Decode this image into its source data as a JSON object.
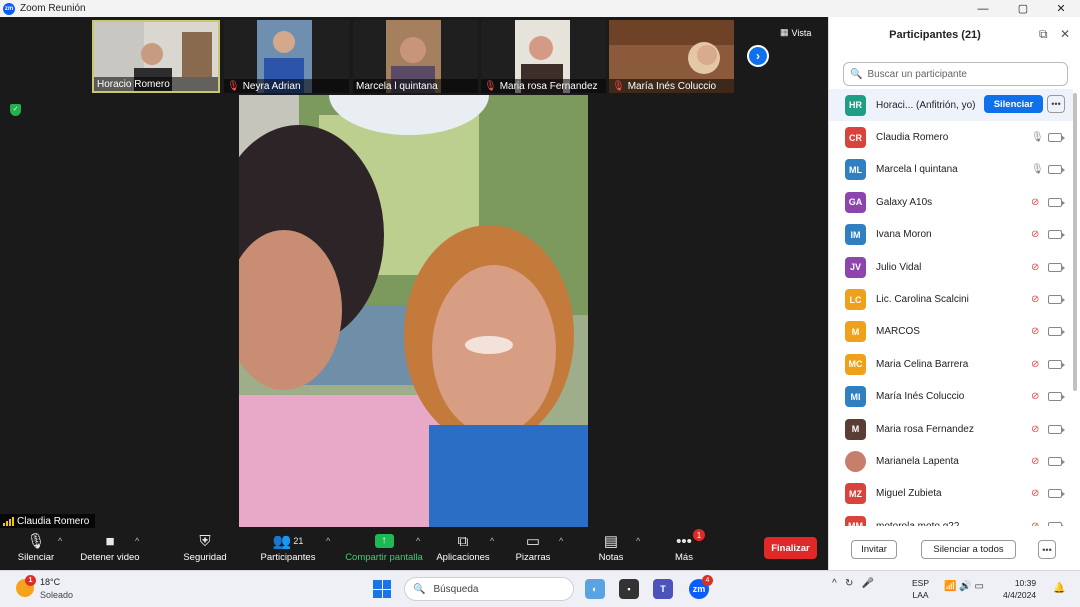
{
  "window": {
    "title": "Zoom Reunión",
    "logo_text": "zm"
  },
  "thumbnails": [
    {
      "name": "Horacio Romero",
      "muted": false,
      "active": true
    },
    {
      "name": "Neyra Adrian",
      "muted": true,
      "active": false
    },
    {
      "name": "Marcela l quintana",
      "muted": false,
      "active": false
    },
    {
      "name": "Maria rosa Fernandez",
      "muted": true,
      "active": false
    },
    {
      "name": "María Inés Coluccio",
      "muted": true,
      "active": false
    }
  ],
  "view_label": "Vista",
  "speaker": {
    "name": "Claudia Romero"
  },
  "toolbar": {
    "mute": "Silenciar",
    "video": "Detener video",
    "security": "Seguridad",
    "participants": "Participantes",
    "participants_count": "21",
    "share": "Compartir pantalla",
    "apps": "Aplicaciones",
    "whiteboards": "Pizarras",
    "notes": "Notas",
    "more": "Más",
    "more_badge": "1",
    "end": "Finalizar"
  },
  "panel": {
    "title": "Participantes (21)",
    "search_placeholder": "Buscar un participante",
    "host_mute_button": "Silenciar",
    "invite": "Invitar",
    "mute_all": "Silenciar a todos",
    "participants": [
      {
        "initials": "HR",
        "name": "Horaci... (Anfitrión, yo)",
        "color": "#1f9e86",
        "mic": "none",
        "host": true
      },
      {
        "initials": "CR",
        "name": "Claudia Romero",
        "color": "#d9433b",
        "mic": "live"
      },
      {
        "initials": "ML",
        "name": "Marcela l quintana",
        "color": "#2f7fc1",
        "mic": "live"
      },
      {
        "initials": "GA",
        "name": "Galaxy A10s",
        "color": "#8e44ad",
        "mic": "muted"
      },
      {
        "initials": "IM",
        "name": "Ivana Moron",
        "color": "#2f7fc1",
        "mic": "muted"
      },
      {
        "initials": "JV",
        "name": "Julio Vidal",
        "color": "#8e44ad",
        "mic": "muted"
      },
      {
        "initials": "LC",
        "name": "Lic. Carolina Scalcini",
        "color": "#f0a11b",
        "mic": "muted"
      },
      {
        "initials": "M",
        "name": "MARCOS",
        "color": "#f0a11b",
        "mic": "muted"
      },
      {
        "initials": "MC",
        "name": "Maria Celina Barrera",
        "color": "#f0a11b",
        "mic": "muted"
      },
      {
        "initials": "MI",
        "name": "María Inés Coluccio",
        "color": "#2f7fc1",
        "mic": "muted"
      },
      {
        "initials": "M",
        "name": "Maria rosa Fernandez",
        "color": "#5a3e36",
        "mic": "muted"
      },
      {
        "initials": "",
        "name": "Marianela Lapenta",
        "color": "#c77f6b",
        "mic": "muted"
      },
      {
        "initials": "MZ",
        "name": "Miguel Zubieta",
        "color": "#d9433b",
        "mic": "muted"
      },
      {
        "initials": "MM",
        "name": "motorola moto g22",
        "color": "#d9433b",
        "mic": "muted"
      }
    ]
  },
  "taskbar": {
    "temp": "18°C",
    "condition": "Soleado",
    "weather_badge": "1",
    "search": "Búsqueda",
    "zoom_badge": "4",
    "lang1": "ESP",
    "lang2": "LAA",
    "time": "10:39",
    "date": "4/4/2024"
  }
}
